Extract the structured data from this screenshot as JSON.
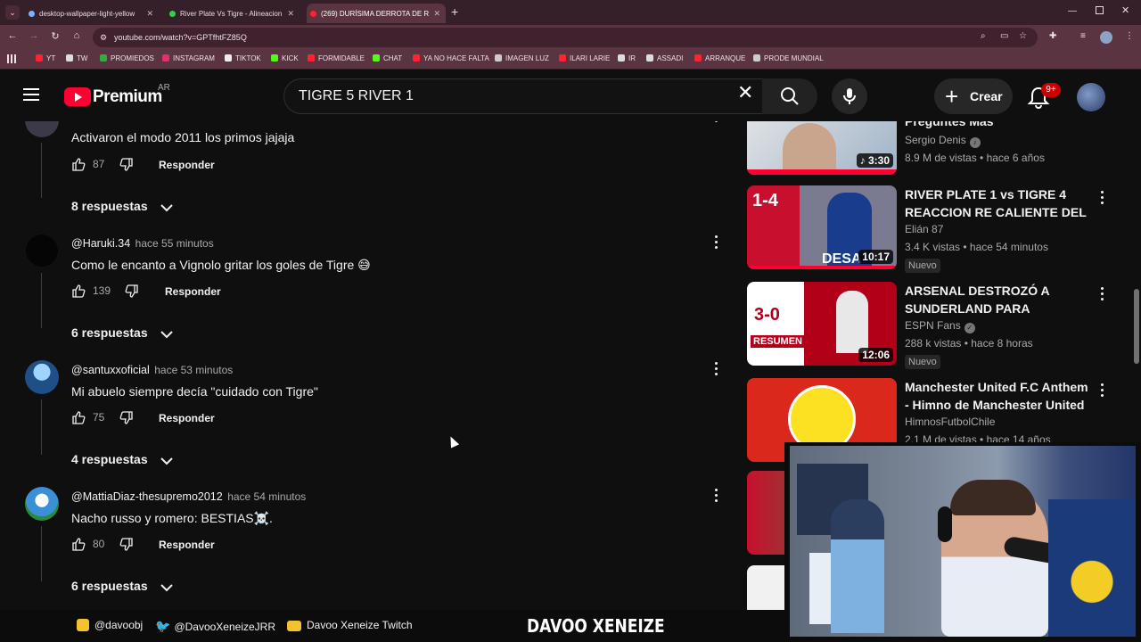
{
  "browser": {
    "tabs": [
      {
        "label": "desktop-wallpaper-light-yellow",
        "favicon_color": "#7fb0ff"
      },
      {
        "label": "River Plate Vs Tigre - Alineacion",
        "favicon_color": "#33cc55"
      },
      {
        "label": "(269) DURÍSIMA DERROTA DE R",
        "favicon_color": "#ff2233"
      }
    ],
    "new_tab": "+",
    "url": "youtube.com/watch?v=GPTfhtFZ85Q",
    "bookmarks": [
      {
        "label": "YT",
        "color": "#ff2233"
      },
      {
        "label": "TW",
        "color": "#dddddd"
      },
      {
        "label": "PROMIEDOS",
        "color": "#33aa44"
      },
      {
        "label": "INSTAGRAM",
        "color": "#e1306c"
      },
      {
        "label": "TIKTOK",
        "color": "#eeeeee"
      },
      {
        "label": "KICK",
        "color": "#53fc18"
      },
      {
        "label": "FORMIDABLE",
        "color": "#ff2233"
      },
      {
        "label": "CHAT",
        "color": "#53fc18"
      },
      {
        "label": "YA NO HACE FALTA",
        "color": "#ff2233"
      },
      {
        "label": "IMAGEN LUZ",
        "color": "#cccccc"
      },
      {
        "label": "ILARI LARIE",
        "color": "#ff2233"
      },
      {
        "label": "IR",
        "color": "#dddddd"
      },
      {
        "label": "ASSADI",
        "color": "#dddddd"
      },
      {
        "label": "ARRANQUE",
        "color": "#ff2233"
      },
      {
        "label": "PRODE MUNDIAL",
        "color": "#cccccc"
      }
    ]
  },
  "youtube": {
    "logo": "Premium",
    "country": "AR",
    "search_value": "TIGRE 5 RIVER 1",
    "create_label": "Crear",
    "notifications": "9+"
  },
  "comments": [
    {
      "author": "",
      "time": "",
      "text": "Activaron el modo 2011 los primos jajaja",
      "likes": "87",
      "reply_label": "Responder",
      "replies_label": "8 respuestas",
      "avatar_color": "#3a3a48"
    },
    {
      "author": "@Haruki.34",
      "time": "hace 55 minutos",
      "text": "Como le encanto a Vignolo gritar los goles de Tigre 😅",
      "likes": "139",
      "reply_label": "Responder",
      "replies_label": "6 respuestas",
      "avatar_color": "#050505"
    },
    {
      "author": "@santuxxoficial",
      "time": "hace 53 minutos",
      "text": "Mi abuelo siempre decía \"cuidado con Tigre\"",
      "likes": "75",
      "reply_label": "Responder",
      "replies_label": "4 respuestas",
      "avatar_color": "#2e6fa8"
    },
    {
      "author": "@MattiaDiaz-thesupremo2012",
      "time": "hace 54 minutos",
      "text": "Nacho russo y romero: BESTIAS☠️.",
      "likes": "80",
      "reply_label": "Responder",
      "replies_label": "6 respuestas",
      "avatar_color": "#3b8fd6"
    }
  ],
  "recommendations": [
    {
      "title": "Preguntes Más",
      "channel": "Sergio Denis",
      "verified": true,
      "meta": "8.9 M de vistas • hace 6 años",
      "duration": "3:30",
      "is_music": true,
      "new_label": "",
      "thumb_colors": [
        "#d9d9d9",
        "#9fb3c7"
      ]
    },
    {
      "title": "RIVER PLATE 1 vs TIGRE 4 REACCION RE CALIENTE DEL ...",
      "channel": "Elián 87",
      "verified": false,
      "meta": "3.4 K vistas • hace 54 minutos",
      "duration": "10:17",
      "is_music": false,
      "new_label": "Nuevo",
      "thumb_colors": [
        "#c8102e",
        "#1a3c8c"
      ]
    },
    {
      "title": "ARSENAL DESTROZÓ A SUNDERLAND PARA SACARLE...",
      "channel": "ESPN Fans",
      "verified": true,
      "meta": "288 k vistas • hace 8 horas",
      "duration": "12:06",
      "is_music": false,
      "new_label": "Nuevo",
      "thumb_colors": [
        "#ffffff",
        "#b30019"
      ]
    },
    {
      "title": "Manchester United F.C Anthem - Himno de Manchester United",
      "channel": "HimnosFutbolChile",
      "verified": false,
      "meta": "2.1 M de vistas • hace 14 años",
      "duration": "",
      "is_music": false,
      "new_label": "",
      "thumb_colors": [
        "#da291c",
        "#da291c"
      ]
    }
  ],
  "stream_bar": {
    "instagram": "@davoobj",
    "twitter": "@DavooXeneizeJRR",
    "twitch": "Davoo Xeneize Twitch",
    "brand": "DAVOO XENEIZE"
  }
}
